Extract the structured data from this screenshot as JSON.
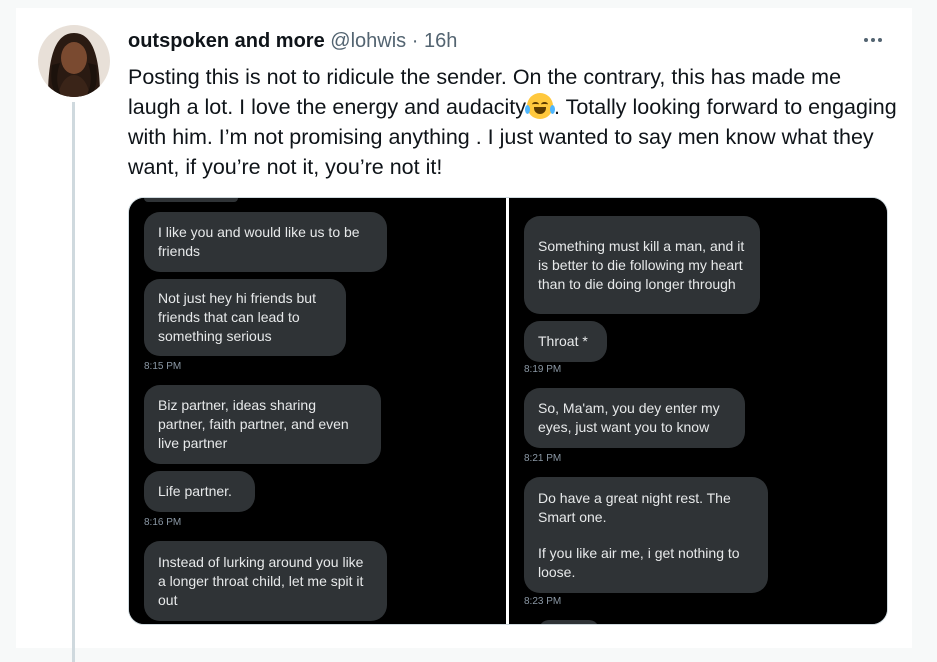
{
  "tweet": {
    "display_name": "outspoken and more",
    "handle": "@lohwis",
    "separator": "·",
    "time": "16h",
    "text_before_emoji": "Posting this is not to ridicule the sender. On the contrary, this has made me laugh a lot. I love the energy and audacity",
    "emoji": "face-with-tears-of-joy-icon",
    "text_after_emoji": ". Totally looking forward to engaging with him. I’m not promising anything . I just wanted to say men know what they want, if you’re not it, you’re not it!"
  },
  "screenshot_left": {
    "messages": [
      "I like you and would like us to be friends",
      "Not just hey hi friends but friends that can lead to something serious",
      "Biz partner, ideas sharing partner, faith partner, and even live partner",
      "Life partner.",
      "Instead of lurking around you like a longer throat child,  let me spit it out"
    ],
    "timestamps": [
      "8:15 PM",
      "8:16 PM"
    ]
  },
  "screenshot_right": {
    "messages": [
      "Something must kill a man, and it is better to die following my heart than to die doing longer through",
      "Throat *",
      "So, Ma'am, you dey enter my eyes, just want you to know",
      "Do have a great night rest. The Smart one.",
      "If you like air me, i get nothing to loose."
    ],
    "timestamps": [
      "8:19 PM",
      "8:21 PM",
      "8:23 PM"
    ]
  },
  "colors": {
    "background": "#f7f9f9",
    "card": "#ffffff",
    "text": "#0f1419",
    "secondary_text": "#536471",
    "bubble": "#2f3336",
    "bubble_text": "#e7e9ea",
    "timestamp_text": "#8b98a5"
  }
}
